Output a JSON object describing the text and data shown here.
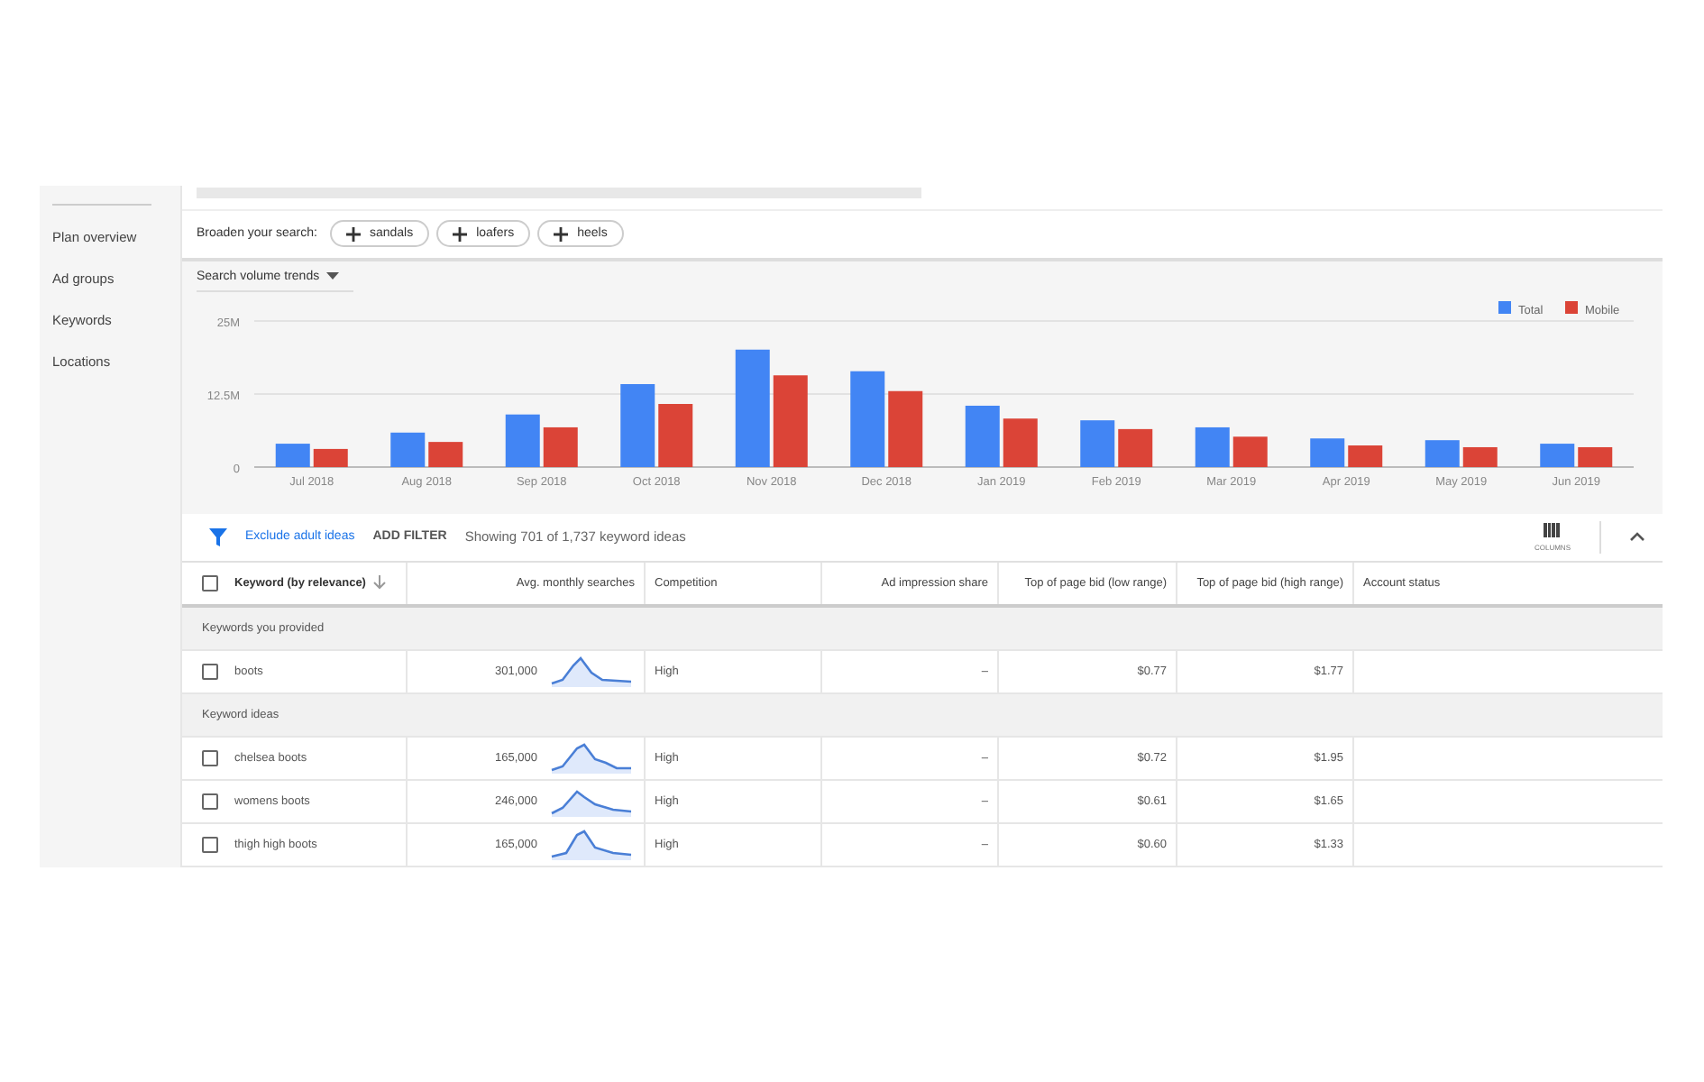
{
  "sidebar": {
    "items": [
      {
        "label": "Plan overview",
        "selected": false
      },
      {
        "label": "Ad groups",
        "selected": false
      },
      {
        "label": "Keywords",
        "selected": false
      },
      {
        "label": "Locations",
        "selected": false
      }
    ]
  },
  "broaden": {
    "label": "Broaden your search:",
    "chips": [
      "sandals",
      "loafers",
      "heels"
    ]
  },
  "trends": {
    "dropdown": "Search volume trends",
    "chart_data": {
      "type": "bar",
      "categories": [
        "Jul 2018",
        "Aug 2018",
        "Sep 2018",
        "Oct 2018",
        "Nov 2018",
        "Dec 2018",
        "Jan 2019",
        "Feb 2019",
        "Mar 2019",
        "Apr 2019",
        "May 2019",
        "Jun 2019"
      ],
      "ylim": [
        0,
        25
      ],
      "legend": true,
      "yticks": [
        {
          "value": 0,
          "label": "0"
        },
        {
          "value": 12.5,
          "label": "12.5M"
        },
        {
          "value": 25,
          "label": "25M"
        }
      ],
      "series": [
        {
          "name": "Total",
          "color": "#4285f4",
          "values": [
            4.0,
            5.9,
            9.0,
            14.2,
            20.1,
            16.4,
            10.5,
            8.0,
            6.8,
            4.9,
            4.6,
            4.0
          ]
        },
        {
          "name": "Mobile",
          "color": "#db4437",
          "values": [
            3.1,
            4.3,
            6.8,
            10.8,
            15.7,
            13.0,
            8.3,
            6.5,
            5.2,
            3.7,
            3.4,
            3.4
          ]
        }
      ]
    }
  },
  "filter_bar": {
    "exclude_link": "Exclude adult ideas",
    "add_filter": "ADD FILTER",
    "summary": "Showing 701 of 1,737 keyword ideas",
    "columns_label": "COLUMNS"
  },
  "table": {
    "select_all_checked": false,
    "columns": [
      "Keyword (by relevance)",
      "Avg. monthly searches",
      "Competition",
      "Ad impression share",
      "Top of page bid (low range)",
      "Top of page bid (high range)",
      "Account status"
    ],
    "rows": [
      {
        "kind": "group",
        "label": "Keywords you provided"
      },
      {
        "kind": "keyword",
        "checked": false,
        "keyword": "boots",
        "searches": "301,000",
        "competition": "High",
        "impression_share": "–",
        "bid_low": "$0.77",
        "bid_high": "$1.77"
      },
      {
        "kind": "group",
        "label": "Keyword ideas"
      },
      {
        "kind": "keyword",
        "checked": false,
        "keyword": "chelsea boots",
        "searches": "165,000",
        "competition": "High",
        "impression_share": "–",
        "bid_low": "$0.72",
        "bid_high": "$1.95"
      },
      {
        "kind": "keyword",
        "checked": false,
        "keyword": "womens boots",
        "searches": "246,000",
        "competition": "High",
        "impression_share": "–",
        "bid_low": "$0.61",
        "bid_high": "$1.65"
      },
      {
        "kind": "keyword",
        "checked": false,
        "keyword": "thigh high boots",
        "searches": "165,000",
        "competition": "High",
        "impression_share": "–",
        "bid_low": "$0.60",
        "bid_high": "$1.33"
      }
    ]
  }
}
